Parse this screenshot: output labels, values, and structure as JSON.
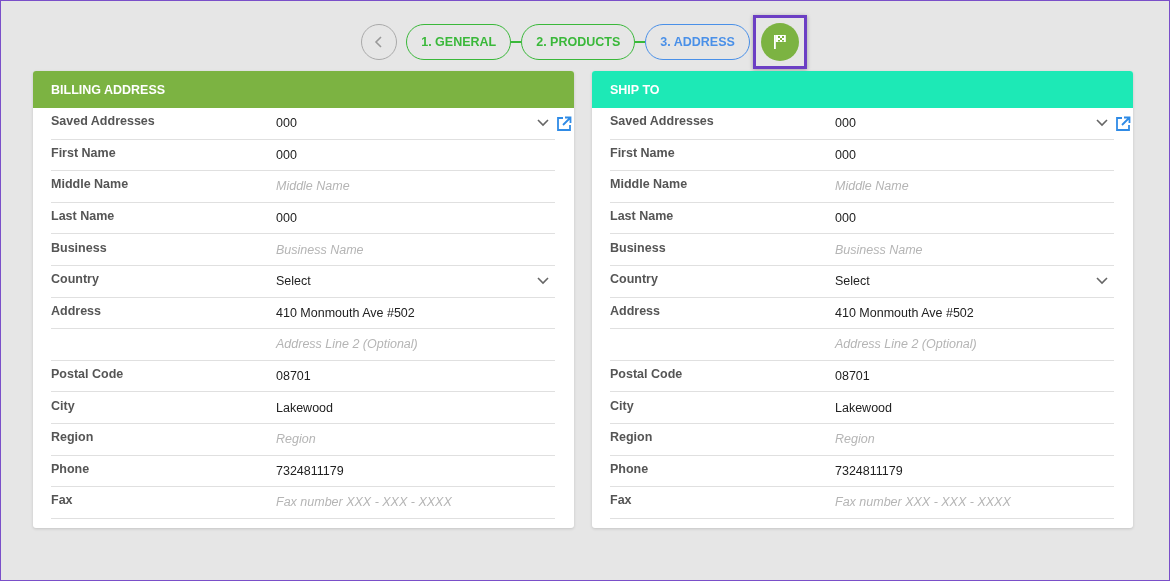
{
  "stepper": {
    "steps": [
      {
        "label": "1. GENERAL",
        "selected": false
      },
      {
        "label": "2. PRODUCTS",
        "selected": false
      },
      {
        "label": "3. ADDRESS",
        "selected": true
      }
    ],
    "finish": {
      "focused": true
    }
  },
  "panels": [
    {
      "title": "BILLING ADDRESS",
      "color": "#7cb342",
      "fields": [
        {
          "label": "Saved Addresses",
          "kind": "select",
          "value": "000",
          "link": true
        },
        {
          "label": "First Name",
          "kind": "text",
          "value": "000"
        },
        {
          "label": "Middle Name",
          "kind": "text",
          "placeholder": "Middle Name"
        },
        {
          "label": "Last Name",
          "kind": "text",
          "value": "000"
        },
        {
          "label": "Business",
          "kind": "text",
          "placeholder": "Business Name"
        },
        {
          "label": "Country",
          "kind": "select",
          "value": "Select"
        },
        {
          "label": "Address",
          "kind": "text",
          "value": "410 Monmouth Ave #502"
        },
        {
          "kind": "text",
          "placeholder": "Address Line 2 (Optional)"
        },
        {
          "label": "Postal Code",
          "kind": "text",
          "value": "08701"
        },
        {
          "label": "City",
          "kind": "text",
          "value": "Lakewood"
        },
        {
          "label": "Region",
          "kind": "text",
          "placeholder": "Region"
        },
        {
          "label": "Phone",
          "kind": "text",
          "value": "7324811179"
        },
        {
          "label": "Fax",
          "kind": "text",
          "placeholder": "Fax number XXX - XXX - XXXX"
        }
      ]
    },
    {
      "title": "SHIP TO",
      "color": "#1de9b6",
      "fields": [
        {
          "label": "Saved Addresses",
          "kind": "select",
          "value": "000",
          "link": true
        },
        {
          "label": "First Name",
          "kind": "text",
          "value": "000"
        },
        {
          "label": "Middle Name",
          "kind": "text",
          "placeholder": "Middle Name"
        },
        {
          "label": "Last Name",
          "kind": "text",
          "value": "000"
        },
        {
          "label": "Business",
          "kind": "text",
          "placeholder": "Business Name"
        },
        {
          "label": "Country",
          "kind": "select",
          "value": "Select"
        },
        {
          "label": "Address",
          "kind": "text",
          "value": "410 Monmouth Ave #502"
        },
        {
          "kind": "text",
          "placeholder": "Address Line 2 (Optional)"
        },
        {
          "label": "Postal Code",
          "kind": "text",
          "value": "08701"
        },
        {
          "label": "City",
          "kind": "text",
          "value": "Lakewood"
        },
        {
          "label": "Region",
          "kind": "text",
          "placeholder": "Region"
        },
        {
          "label": "Phone",
          "kind": "text",
          "value": "7324811179"
        },
        {
          "label": "Fax",
          "kind": "text",
          "placeholder": "Fax number XXX - XXX - XXXX"
        }
      ]
    }
  ]
}
